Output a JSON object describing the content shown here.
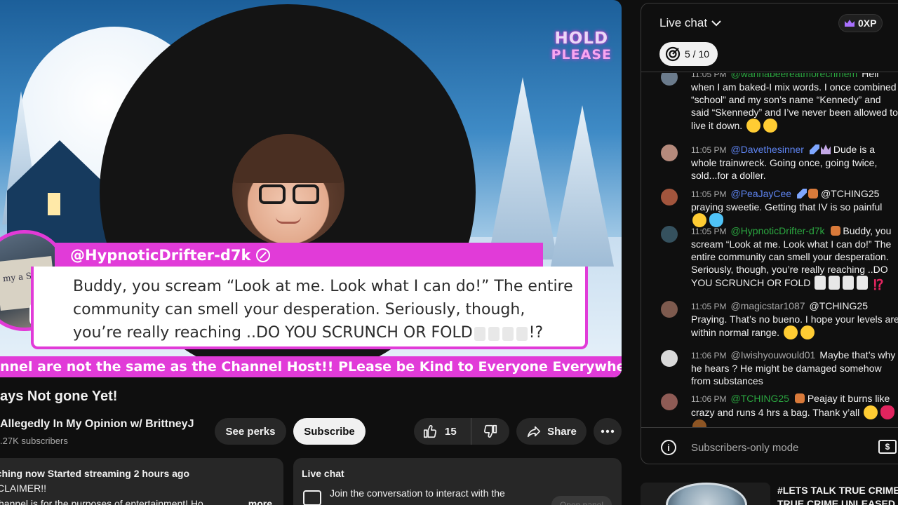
{
  "video": {
    "hold_line1": "HOLD",
    "hold_line2": "PLEASE",
    "overlay_username": "@HypnoticDrifter-d7k",
    "overlay_message": "Buddy, you scream “Look at me. Look what I can do!” The entire community can smell your desperation. Seriously, though, you’re really reaching ..DO YOU SCRUNCH OR FOLD",
    "overlay_message_end": "!?",
    "ticker": "nnel are not the same as the Channel Host!! PLease be Kind to Everyone Everywhere!! **Discl"
  },
  "title": "ays Not gone Yet!",
  "channel": {
    "name": "Allegedly In My Opinion w/ BrittneyJ",
    "subscribers": ".27K subscribers"
  },
  "actions": {
    "perks": "See perks",
    "subscribe": "Subscribe",
    "likes": "15",
    "share": "Share"
  },
  "description": {
    "meta": "tching now  Started streaming 2 hours ago",
    "line1": "CLAIMER!!",
    "line2": "hannel is for the purposes of entertainment!  Ho",
    "more": "...more"
  },
  "chat_card": {
    "title": "Live chat",
    "join": "Join the conversation to interact with the",
    "open_panel": "Open panel"
  },
  "chat": {
    "title": "Live chat",
    "xp": "0XP",
    "goal": "5 / 10",
    "footer": "Subscribers-only mode",
    "messages": [
      {
        "time": "11:05 PM",
        "author": "@wannabeereatmorecrimem",
        "text": "Hell when I am baked-I mix words. I once combined “school” and my son’s name “Kennedy” and said “Skennedy” and I’ve never been allowed to live it down."
      },
      {
        "time": "11:05 PM",
        "author": "@Davethesinner",
        "text": "Dude is a whole trainwreck. Going once, going twice, sold...for a doller."
      },
      {
        "time": "11:05 PM",
        "author": "@PeaJayCee",
        "text": "@TCHING25 praying sweetie. Getting that IV is so painful"
      },
      {
        "time": "11:05 PM",
        "author": "@HypnoticDrifter-d7k",
        "text": "Buddy, you scream “Look at me. Look what I can do!” The entire community can smell your desperation. Seriously, though, you’re really reaching ..DO YOU SCRUNCH OR FOLD"
      },
      {
        "time": "11:05 PM",
        "author": "@magicstar1087",
        "text": "@TCHING25 Praying. That’s no bueno. I hope your levels are within normal range."
      },
      {
        "time": "11:06 PM",
        "author": "@Iwishyouwould01",
        "text": "Maybe that’s why he hears ? He might be damaged somehow from substances"
      },
      {
        "time": "11:06 PM",
        "author": "@TCHING25",
        "text": "Peajay it burns like crazy and runs 4 hrs a bag. Thank y’all"
      }
    ]
  },
  "recommended": {
    "title": "#LETS TALK TRUE CRIME",
    "subtitle": "TRUE CRIME UNLEASED"
  },
  "colors": {
    "accent_pink": "#e13bd8",
    "green_author": "#2ba640",
    "blue_author": "#5e84f1"
  }
}
